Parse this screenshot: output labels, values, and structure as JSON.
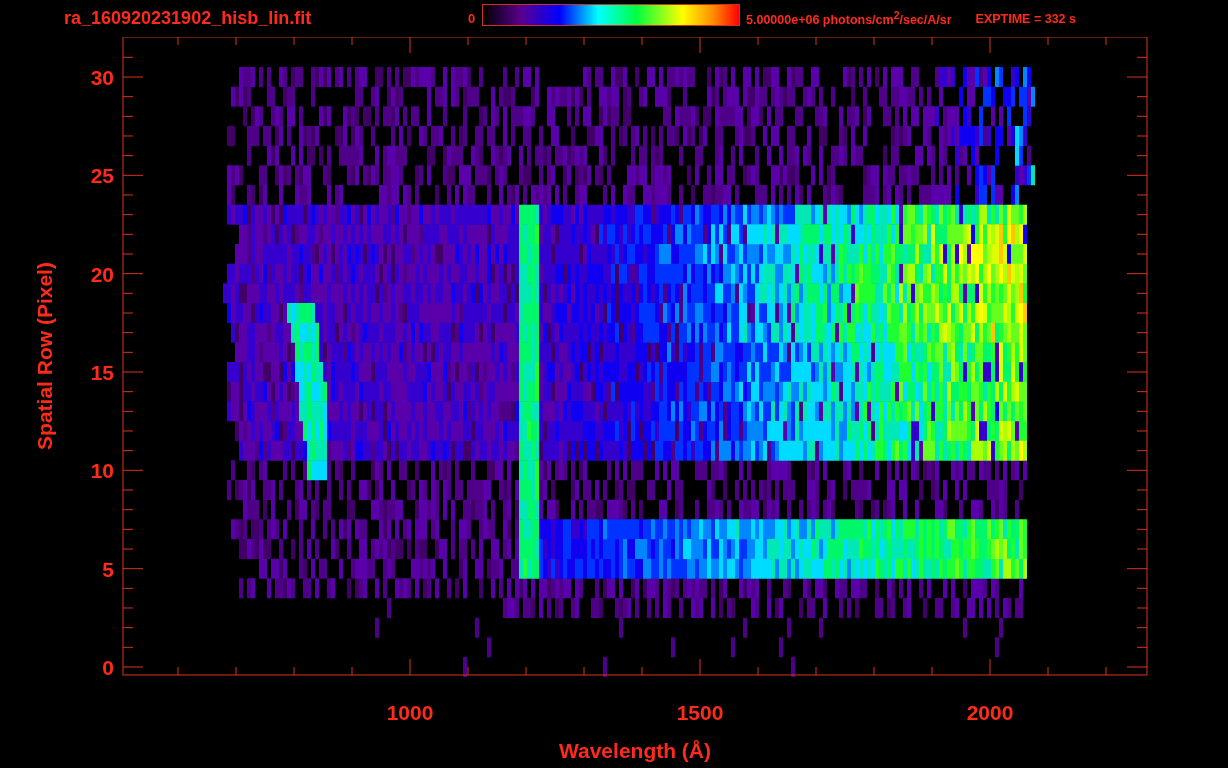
{
  "title": "ra_160920231902_hisb_lin.fit",
  "colorbar": {
    "min_label": "0",
    "max_label": "5.00000e+06 photons/cm$^{2}$/sec/A/sr"
  },
  "exposure": "EXPTIME = 332 s",
  "x_axis": {
    "label": "Wavelength (Å)",
    "tick_labels": [
      "1000",
      "1500",
      "2000"
    ]
  },
  "y_axis": {
    "label": "Spatial Row (Pixel)",
    "tick_labels": [
      "30",
      "25",
      "20",
      "15",
      "10",
      "5",
      "0"
    ]
  }
}
